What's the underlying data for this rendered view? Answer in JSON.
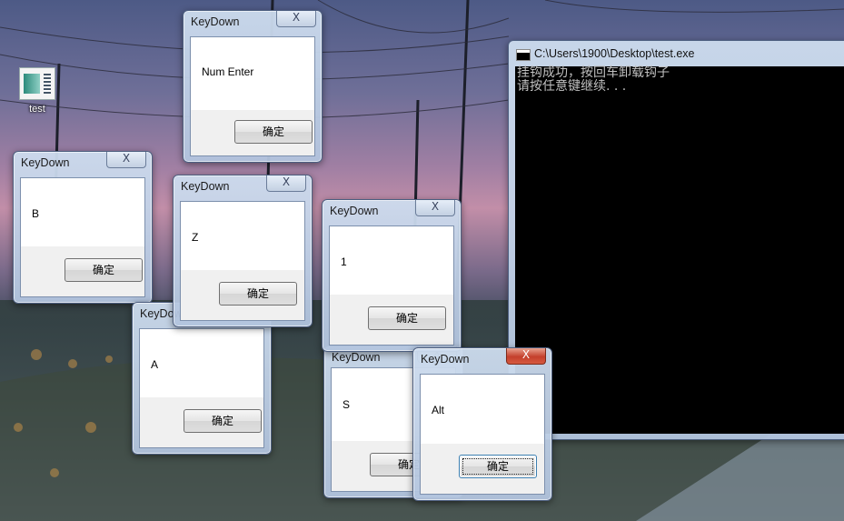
{
  "desktop": {
    "icon_label": "test"
  },
  "console": {
    "title": "C:\\Users\\1900\\Desktop\\test.exe",
    "lines": [
      "挂钩成功，按回车卸载钩子",
      "请按任意键继续. . ."
    ]
  },
  "dialogs": [
    {
      "title": "KeyDown",
      "message": "Num Enter",
      "ok": "确定",
      "close": "X"
    },
    {
      "title": "KeyDown",
      "message": "B",
      "ok": "确定",
      "close": "X"
    },
    {
      "title": "KeyDown",
      "message": "Z",
      "ok": "确定",
      "close": "X"
    },
    {
      "title": "KeyDown",
      "message": "A",
      "ok": "确定",
      "close": "X"
    },
    {
      "title": "KeyDown",
      "message": "1",
      "ok": "确定",
      "close": "X"
    },
    {
      "title": "KeyDown",
      "message": "S",
      "ok": "确定",
      "close": "X"
    },
    {
      "title": "KeyDown",
      "message": "Alt",
      "ok": "确定",
      "close": "X"
    }
  ],
  "colors": {
    "console_bg": "#000000",
    "console_text": "#c0c0c0",
    "close_active": "#c4402c"
  }
}
